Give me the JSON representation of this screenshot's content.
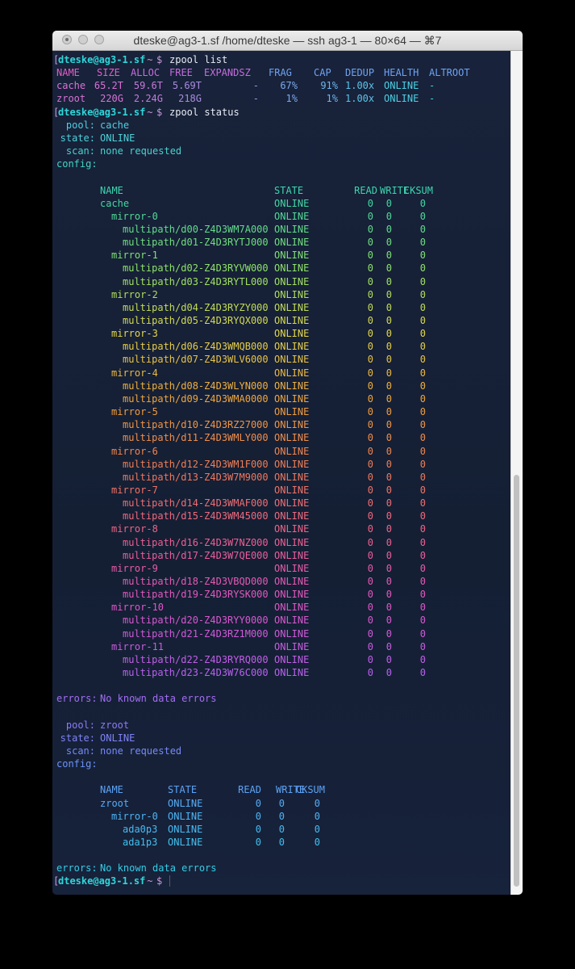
{
  "window": {
    "title": "dteske@ag3-1.sf /home/dteske — ssh ag3-1 — 80×64 — ⌘7"
  },
  "prompt": {
    "user_host": "dteske@ag3-1.sf",
    "sep": " ~ ",
    "dollar": "$"
  },
  "commands": {
    "list": "zpool list",
    "status": "zpool status"
  },
  "zpool_list": {
    "headers": [
      "NAME",
      "SIZE",
      "ALLOC",
      "FREE",
      "EXPANDSZ",
      "FRAG",
      "CAP",
      "DEDUP",
      "HEALTH",
      "ALTROOT"
    ],
    "rows": [
      [
        "cache",
        "65.2T",
        "59.6T",
        "5.69T",
        "-",
        "67%",
        "91%",
        "1.00x",
        "ONLINE",
        "-"
      ],
      [
        "zroot",
        "220G",
        "2.24G",
        "218G",
        "-",
        "1%",
        "1%",
        "1.00x",
        "ONLINE",
        "-"
      ]
    ]
  },
  "pools": [
    {
      "pool_label": "pool:",
      "pool": "cache",
      "state_label": "state:",
      "state": "ONLINE",
      "scan_label": "scan:",
      "scan": "none requested",
      "config_label": "config:",
      "headers": [
        "NAME",
        "STATE",
        "READ",
        "WRITE",
        "CKSUM"
      ],
      "rows": [
        [
          "cache",
          "ONLINE",
          "0",
          "0",
          "0"
        ],
        [
          "mirror-0",
          "ONLINE",
          "0",
          "0",
          "0"
        ],
        [
          "multipath/d00-Z4D3WM7A000",
          "ONLINE",
          "0",
          "0",
          "0"
        ],
        [
          "multipath/d01-Z4D3RYTJ000",
          "ONLINE",
          "0",
          "0",
          "0"
        ],
        [
          "mirror-1",
          "ONLINE",
          "0",
          "0",
          "0"
        ],
        [
          "multipath/d02-Z4D3RYVW000",
          "ONLINE",
          "0",
          "0",
          "0"
        ],
        [
          "multipath/d03-Z4D3RYTL000",
          "ONLINE",
          "0",
          "0",
          "0"
        ],
        [
          "mirror-2",
          "ONLINE",
          "0",
          "0",
          "0"
        ],
        [
          "multipath/d04-Z4D3RYZY000",
          "ONLINE",
          "0",
          "0",
          "0"
        ],
        [
          "multipath/d05-Z4D3RYQX000",
          "ONLINE",
          "0",
          "0",
          "0"
        ],
        [
          "mirror-3",
          "ONLINE",
          "0",
          "0",
          "0"
        ],
        [
          "multipath/d06-Z4D3WMQB000",
          "ONLINE",
          "0",
          "0",
          "0"
        ],
        [
          "multipath/d07-Z4D3WLV6000",
          "ONLINE",
          "0",
          "0",
          "0"
        ],
        [
          "mirror-4",
          "ONLINE",
          "0",
          "0",
          "0"
        ],
        [
          "multipath/d08-Z4D3WLYN000",
          "ONLINE",
          "0",
          "0",
          "0"
        ],
        [
          "multipath/d09-Z4D3WMA0000",
          "ONLINE",
          "0",
          "0",
          "0"
        ],
        [
          "mirror-5",
          "ONLINE",
          "0",
          "0",
          "0"
        ],
        [
          "multipath/d10-Z4D3RZ27000",
          "ONLINE",
          "0",
          "0",
          "0"
        ],
        [
          "multipath/d11-Z4D3WMLY000",
          "ONLINE",
          "0",
          "0",
          "0"
        ],
        [
          "mirror-6",
          "ONLINE",
          "0",
          "0",
          "0"
        ],
        [
          "multipath/d12-Z4D3WM1F000",
          "ONLINE",
          "0",
          "0",
          "0"
        ],
        [
          "multipath/d13-Z4D3W7M9000",
          "ONLINE",
          "0",
          "0",
          "0"
        ],
        [
          "mirror-7",
          "ONLINE",
          "0",
          "0",
          "0"
        ],
        [
          "multipath/d14-Z4D3WMAF000",
          "ONLINE",
          "0",
          "0",
          "0"
        ],
        [
          "multipath/d15-Z4D3WM45000",
          "ONLINE",
          "0",
          "0",
          "0"
        ],
        [
          "mirror-8",
          "ONLINE",
          "0",
          "0",
          "0"
        ],
        [
          "multipath/d16-Z4D3W7NZ000",
          "ONLINE",
          "0",
          "0",
          "0"
        ],
        [
          "multipath/d17-Z4D3W7QE000",
          "ONLINE",
          "0",
          "0",
          "0"
        ],
        [
          "mirror-9",
          "ONLINE",
          "0",
          "0",
          "0"
        ],
        [
          "multipath/d18-Z4D3VBQD000",
          "ONLINE",
          "0",
          "0",
          "0"
        ],
        [
          "multipath/d19-Z4D3RYSK000",
          "ONLINE",
          "0",
          "0",
          "0"
        ],
        [
          "mirror-10",
          "ONLINE",
          "0",
          "0",
          "0"
        ],
        [
          "multipath/d20-Z4D3RYY0000",
          "ONLINE",
          "0",
          "0",
          "0"
        ],
        [
          "multipath/d21-Z4D3RZ1M000",
          "ONLINE",
          "0",
          "0",
          "0"
        ],
        [
          "mirror-11",
          "ONLINE",
          "0",
          "0",
          "0"
        ],
        [
          "multipath/d22-Z4D3RYRQ000",
          "ONLINE",
          "0",
          "0",
          "0"
        ],
        [
          "multipath/d23-Z4D3W76C000",
          "ONLINE",
          "0",
          "0",
          "0"
        ]
      ],
      "errors_label": "errors:",
      "errors": "No known data errors"
    },
    {
      "pool_label": "pool:",
      "pool": "zroot",
      "state_label": "state:",
      "state": "ONLINE",
      "scan_label": "scan:",
      "scan": "none requested",
      "config_label": "config:",
      "headers": [
        "NAME",
        "STATE",
        "READ",
        "WRITE",
        "CKSUM"
      ],
      "rows": [
        [
          "zroot",
          "ONLINE",
          "0",
          "0",
          "0"
        ],
        [
          "mirror-0",
          "ONLINE",
          "0",
          "0",
          "0"
        ],
        [
          "ada0p3",
          "ONLINE",
          "0",
          "0",
          "0"
        ],
        [
          "ada1p3",
          "ONLINE",
          "0",
          "0",
          "0"
        ]
      ],
      "errors_label": "errors:",
      "errors": "No known data errors"
    }
  ],
  "colors": {
    "background": "#162138",
    "prompt": "#2ed6d9",
    "gradient": [
      "#5ea8f2",
      "#4fd1e0",
      "#3ad7a8",
      "#8be36a",
      "#e4d84a",
      "#f2a23a",
      "#f07a58",
      "#f05f8e",
      "#e056c9",
      "#b860f0",
      "#7a86f8",
      "#4fb2f5",
      "#2fd3e3"
    ]
  }
}
